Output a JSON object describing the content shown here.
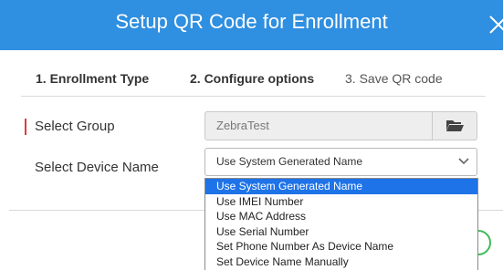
{
  "header": {
    "title": "Setup QR Code for Enrollment"
  },
  "steps": [
    {
      "label": "1. Enrollment Type"
    },
    {
      "label": "2. Configure options"
    },
    {
      "label": "3. Save QR code"
    }
  ],
  "form": {
    "group_label": "Select Group",
    "group_value": "ZebraTest",
    "device_name_label": "Select Device Name",
    "device_name_selected": "Use System Generated Name",
    "device_name_options": [
      "Use System Generated Name",
      "Use IMEI Number",
      "Use MAC Address",
      "Use Serial Number",
      "Set Phone Number As Device Name",
      "Set Device Name Manually"
    ]
  },
  "colors": {
    "header_bg": "#2f8fe0",
    "selected_option_bg": "#1e73e8",
    "required_marker": "#e23a3a"
  },
  "icons": {
    "close": "close-icon",
    "browse": "folder-open-icon",
    "dropdown": "chevron-down-icon"
  }
}
